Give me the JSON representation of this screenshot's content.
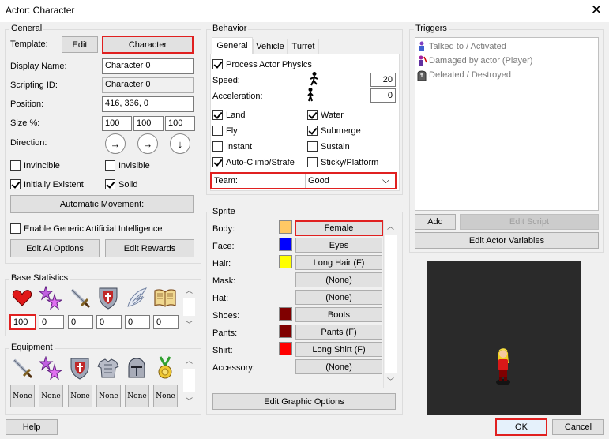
{
  "window": {
    "title": "Actor: Character",
    "close_glyph": "✕"
  },
  "general": {
    "label": "General",
    "template_label": "Template:",
    "edit_label": "Edit",
    "template_value": "Character",
    "display_name_label": "Display Name:",
    "display_name_value": "Character 0",
    "scripting_id_label": "Scripting ID:",
    "scripting_id_value": "Character 0",
    "position_label": "Position:",
    "position_value": "416, 336, 0",
    "size_label": "Size %:",
    "size_values": [
      "100",
      "100",
      "100"
    ],
    "direction_label": "Direction:",
    "direction_arrows": [
      "→",
      "→",
      "↓"
    ],
    "invincible_label": "Invincible",
    "invisible_label": "Invisible",
    "initially_existent_label": "Initially Existent",
    "solid_label": "Solid",
    "automatic_movement_label": "Automatic Movement:",
    "enable_ai_label": "Enable Generic Artificial Intelligence",
    "edit_ai_label": "Edit AI Options",
    "edit_rewards_label": "Edit Rewards"
  },
  "base_stats": {
    "label": "Base Statistics",
    "values": [
      "100",
      "0",
      "0",
      "0",
      "0",
      "0"
    ],
    "icons": [
      "heart-icon",
      "stars-icon",
      "sword-icon",
      "shield-icon",
      "wing-icon",
      "book-icon"
    ]
  },
  "equipment": {
    "label": "Equipment",
    "slots": [
      "None",
      "None",
      "None",
      "None",
      "None",
      "None"
    ],
    "icons": [
      "sword-icon",
      "stars-icon",
      "shield-icon",
      "armor-icon",
      "helmet-icon",
      "medal-icon"
    ]
  },
  "behavior": {
    "label": "Behavior",
    "tabs": [
      "General",
      "Vehicle",
      "Turret"
    ],
    "process_physics_label": "Process Actor Physics",
    "speed_label": "Speed:",
    "speed_value": "20",
    "acceleration_label": "Acceleration:",
    "acceleration_value": "0",
    "land": "Land",
    "water": "Water",
    "fly": "Fly",
    "submerge": "Submerge",
    "instant": "Instant",
    "sustain": "Sustain",
    "autoclimb": "Auto-Climb/Strafe",
    "sticky": "Sticky/Platform",
    "team_label": "Team:",
    "team_value": "Good"
  },
  "sprite": {
    "label": "Sprite",
    "rows": [
      {
        "label": "Body:",
        "value": "Female",
        "color": "#ffc864"
      },
      {
        "label": "Face:",
        "value": "Eyes",
        "color": "#0000ff"
      },
      {
        "label": "Hair:",
        "value": "Long Hair (F)",
        "color": "#ffff00"
      },
      {
        "label": "Mask:",
        "value": "(None)",
        "color": ""
      },
      {
        "label": "Hat:",
        "value": "(None)",
        "color": ""
      },
      {
        "label": "Shoes:",
        "value": "Boots",
        "color": "#800000"
      },
      {
        "label": "Pants:",
        "value": "Pants (F)",
        "color": "#800000"
      },
      {
        "label": "Shirt:",
        "value": "Long Shirt (F)",
        "color": "#ff0000"
      },
      {
        "label": "Accessory:",
        "value": "(None)",
        "color": ""
      }
    ],
    "edit_graphic_label": "Edit Graphic Options"
  },
  "triggers": {
    "label": "Triggers",
    "items": [
      "Talked to / Activated",
      "Damaged by actor (Player)",
      "Defeated / Destroyed"
    ],
    "add_label": "Add",
    "edit_script_label": "Edit Script",
    "edit_vars_label": "Edit Actor Variables"
  },
  "footer": {
    "help_label": "Help",
    "ok_label": "OK",
    "cancel_label": "Cancel"
  }
}
